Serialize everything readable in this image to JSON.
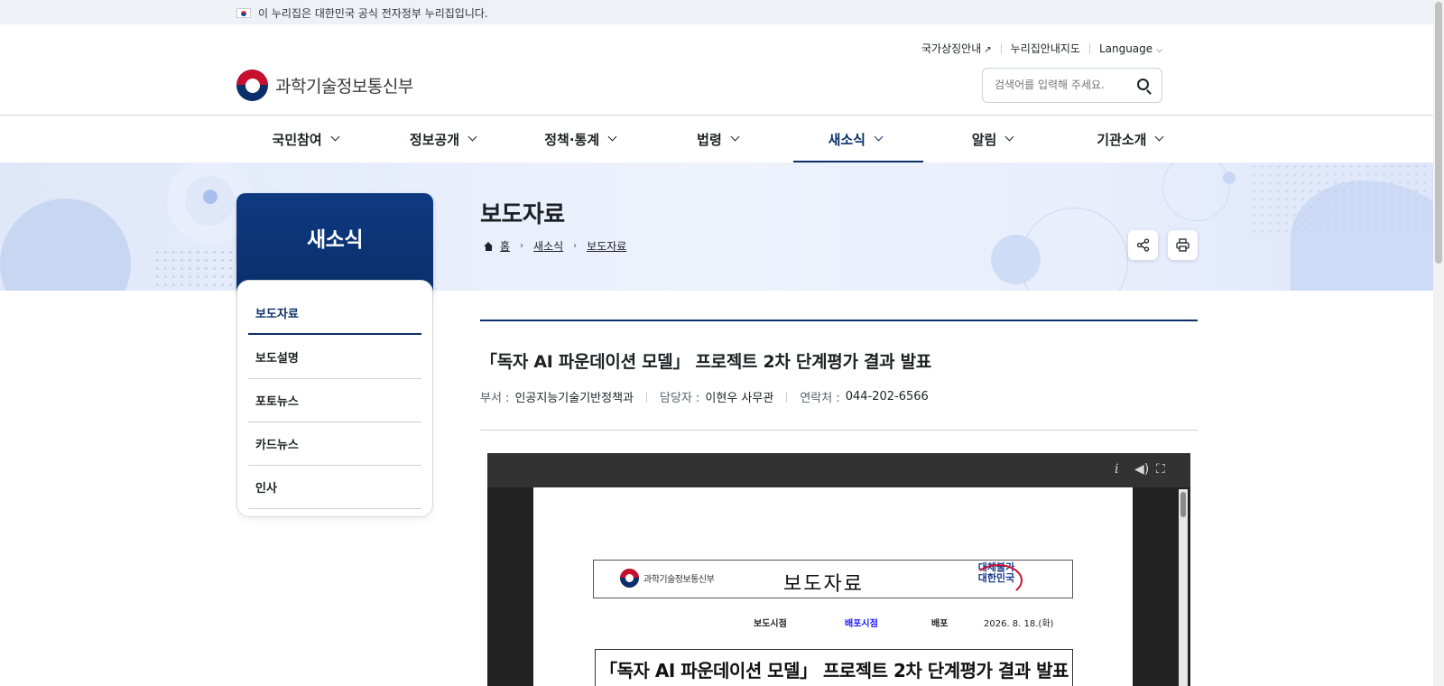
{
  "gov_banner": {
    "text": "이 누리집은 대한민국 공식 전자정부 누리집입니다."
  },
  "header": {
    "logo_text": "과학기술정보통신부",
    "util_links": [
      "국가상징안내",
      "누리집안내지도",
      "Language"
    ],
    "search": {
      "placeholder": "검색어를 입력해 주세요."
    }
  },
  "gnb": {
    "items": [
      "국민참여",
      "정보공개",
      "정책·통계",
      "법령",
      "새소식",
      "알림",
      "기관소개"
    ],
    "active": "새소식"
  },
  "lnb": {
    "title": "새소식",
    "items": [
      "보도자료",
      "보도설명",
      "포토뉴스",
      "카드뉴스",
      "인사"
    ],
    "active": "보도자료"
  },
  "content": {
    "page_title": "보도자료",
    "breadcrumb": [
      "홈",
      "새소식",
      "보도자료"
    ]
  },
  "article": {
    "title": "「독자 AI 파운데이션 모델」 프로젝트 2차 단계평가 결과 발표",
    "meta": [
      {
        "key": "부서 :",
        "value": "인공지능기술기반정책과"
      },
      {
        "key": "담당자 :",
        "value": "이현우 사무관"
      },
      {
        "key": "연락처 :",
        "value": "044-202-6566"
      }
    ]
  },
  "viewer": {
    "icons": [
      "info-icon",
      "sound-icon",
      "fullscreen-icon"
    ],
    "document": {
      "org": "과학기술정보통신부",
      "heading": "보도자료",
      "seal_text": "대체불가\n대한민국",
      "row": [
        "보도시점",
        "배포시점",
        "배포",
        "2026. 8. 18.(화)"
      ],
      "headline": "「독자 AI 파운데이션 모델」 프로젝트 2차 단계평가 결과 발표"
    }
  },
  "colors": {
    "primary": "#0b2f6b",
    "accent_red": "#c8102e",
    "banner_bg": "#eef2f7"
  }
}
